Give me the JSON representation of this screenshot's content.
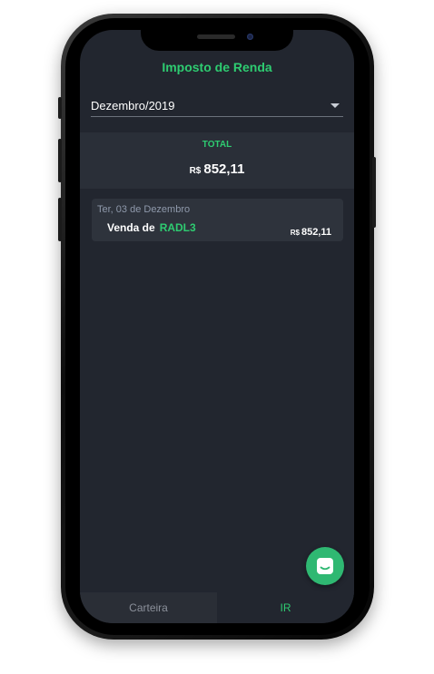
{
  "app": {
    "title": "Imposto de Renda"
  },
  "filter": {
    "month_value": "Dezembro/2019"
  },
  "summary": {
    "label": "TOTAL",
    "currency": "R$",
    "amount": "852,11"
  },
  "transactions": [
    {
      "date": "Ter, 03 de Dezembro",
      "description": "Venda de",
      "ticker": "RADL3",
      "currency": "R$",
      "amount": "852,11"
    }
  ],
  "tabs": [
    {
      "label": "Carteira",
      "active": false
    },
    {
      "label": "IR",
      "active": true
    }
  ],
  "fab": {
    "icon": "chat-icon"
  },
  "colors": {
    "accent": "#2ecc71",
    "background": "#22262f",
    "panel": "#2a2f38",
    "card": "#2e333c"
  }
}
